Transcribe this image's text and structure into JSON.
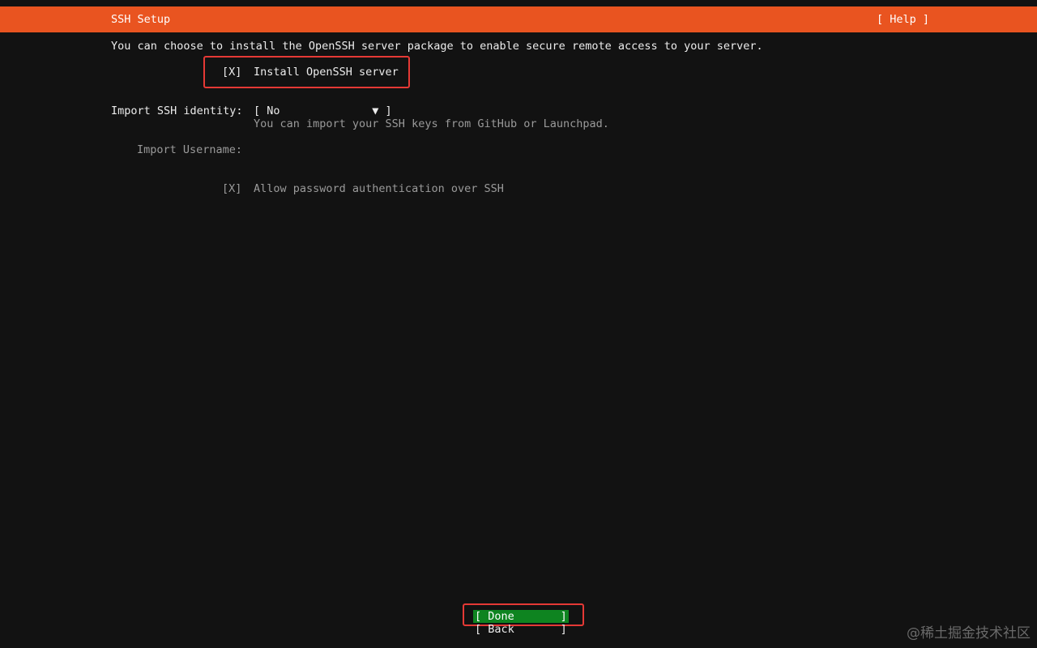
{
  "header": {
    "title": "SSH Setup",
    "help_label": "[ Help ]"
  },
  "description": "You can choose to install the OpenSSH server package to enable secure remote access to your server.",
  "install_openssh": {
    "checkbox": "[X]",
    "label": "Install OpenSSH server"
  },
  "import_identity": {
    "label": "Import SSH identity:",
    "select_value": "[ No              ▼ ]",
    "help": "You can import your SSH keys from GitHub or Launchpad."
  },
  "import_username": {
    "label": "Import Username:",
    "value": ""
  },
  "allow_password": {
    "checkbox": "[X]",
    "label": "Allow password authentication over SSH"
  },
  "buttons": {
    "done": "[ Done       ]",
    "back": "[ Back       ]"
  },
  "watermark": "@稀土掘金技术社区",
  "colors": {
    "header_bg": "#e95420",
    "done_bg": "#0e8420",
    "highlight": "#e53935",
    "background": "#121212"
  }
}
